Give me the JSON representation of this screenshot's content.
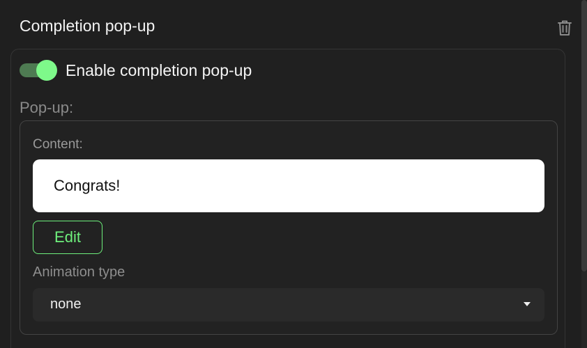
{
  "section": {
    "title": "Completion pop-up",
    "delete_icon": "trash-icon"
  },
  "toggle": {
    "label": "Enable completion pop-up",
    "enabled": true,
    "accent_color": "#7ef98a"
  },
  "popup": {
    "label": "Pop-up:",
    "content_label": "Content:",
    "content_value": "Congrats!",
    "edit_label": "Edit",
    "animation_label": "Animation type",
    "animation_value": "none",
    "caret_icon": "caret-down-icon"
  }
}
